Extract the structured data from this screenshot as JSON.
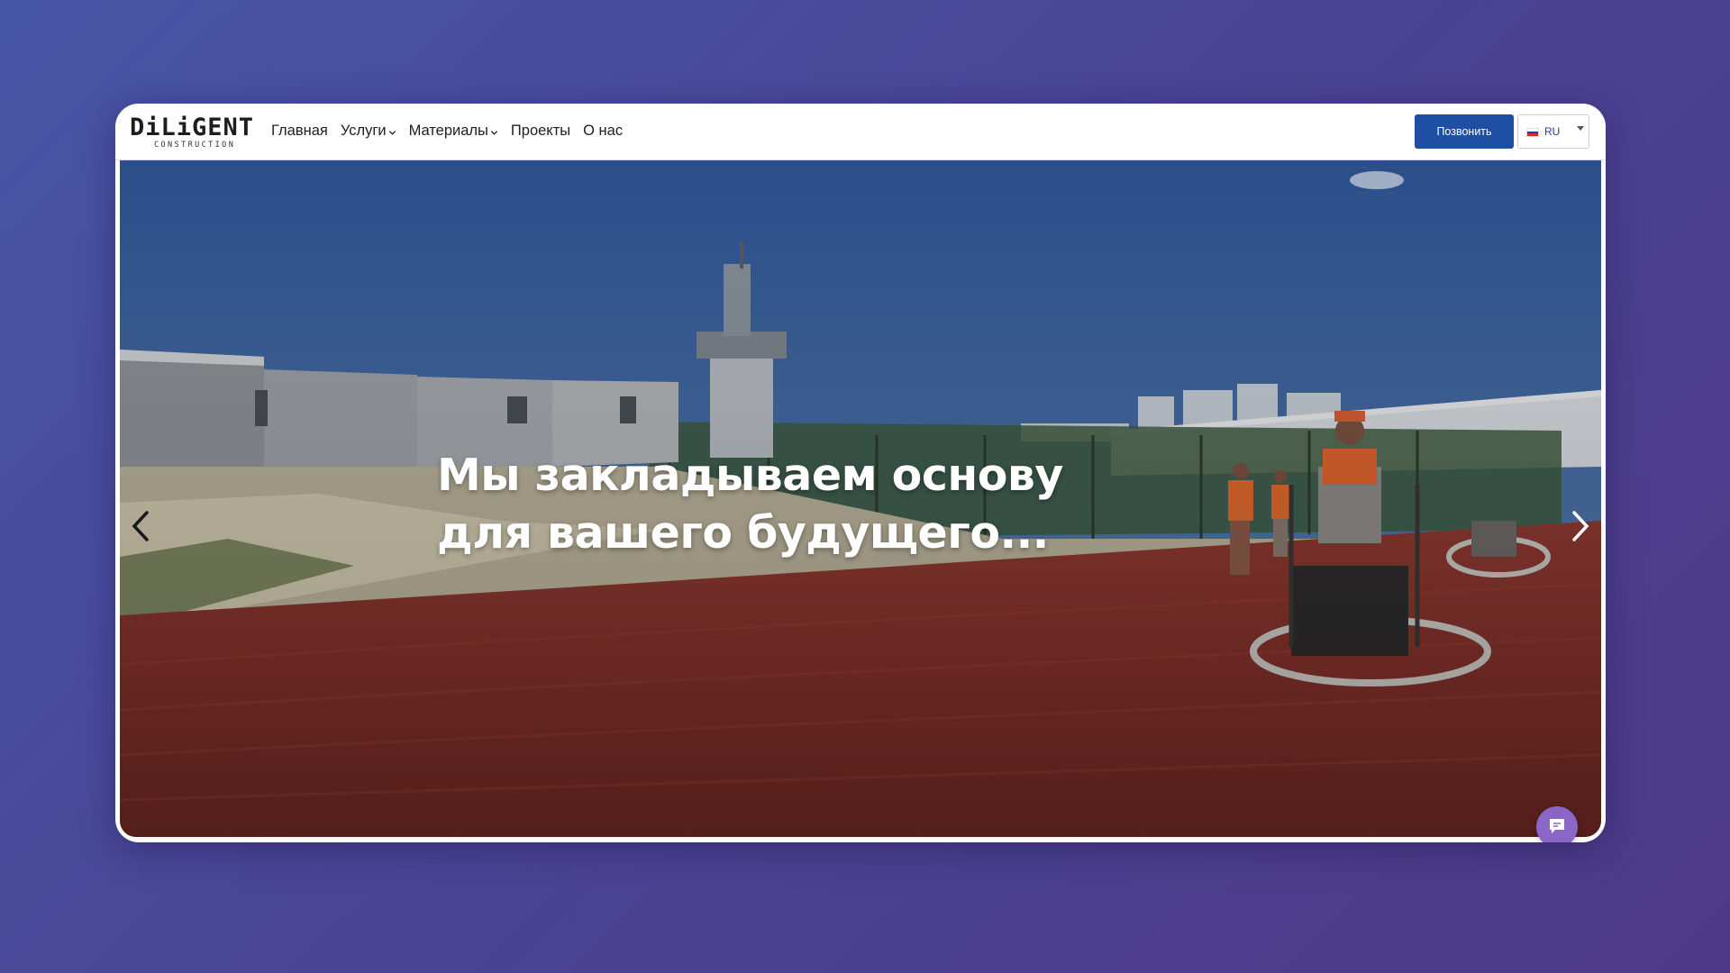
{
  "brand": {
    "logo_main": "DiLiGENT",
    "logo_sub": "CONSTRUCTION"
  },
  "nav": {
    "items": [
      {
        "label": "Главная"
      },
      {
        "label": "Услуги"
      },
      {
        "label": "Материалы"
      },
      {
        "label": "Проекты"
      },
      {
        "label": "О нас"
      }
    ]
  },
  "header": {
    "call_button": "Позвонить",
    "language": "RU"
  },
  "hero": {
    "title_line1": "Мы закладываем основу",
    "title_line2": "для вашего будущего..."
  },
  "colors": {
    "accent": "#1f4fa2",
    "chat_widget": "#8a67c7",
    "background_gradient_start": "#4656a6",
    "background_gradient_end": "#4d3a86"
  },
  "icons": {
    "prev": "chevron-left-icon",
    "next": "chevron-right-icon",
    "chat": "chat-bubble-icon",
    "dropdown": "chevron-down-icon",
    "flag": "flag-ru-icon"
  }
}
